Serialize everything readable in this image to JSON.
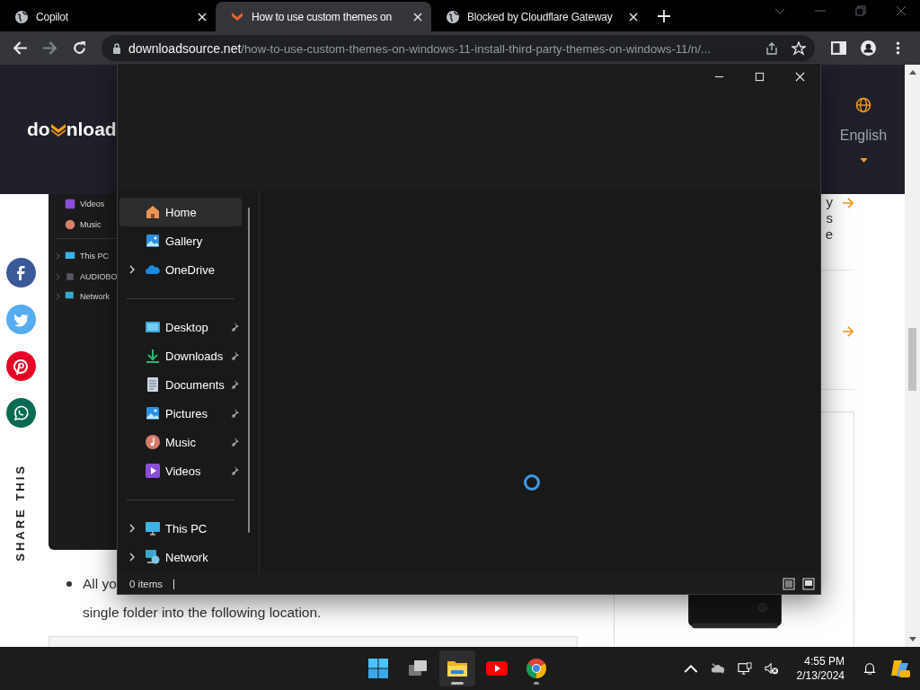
{
  "browser": {
    "tabs": [
      {
        "title": "Copilot",
        "kind": "globe",
        "selected": false
      },
      {
        "title": "How to use custom themes on",
        "kind": "site",
        "selected": true
      },
      {
        "title": "Blocked by Cloudflare Gateway",
        "kind": "globe",
        "selected": false
      }
    ],
    "address": {
      "domain": "downloadsource.net",
      "path": "/how-to-use-custom-themes-on-windows-11-install-third-party-themes-on-windows-11/n/..."
    }
  },
  "page": {
    "header": {
      "logo_start": "do",
      "logo_end": "nload",
      "language": "English"
    },
    "share": {
      "label": "SHARE THIS",
      "buttons": [
        {
          "kind": "facebook",
          "color": "#3b5998"
        },
        {
          "kind": "twitter",
          "color": "#55acee"
        },
        {
          "kind": "pinterest",
          "color": "#e60023"
        },
        {
          "kind": "whatsapp",
          "color": "#0b6b52"
        }
      ]
    },
    "article": {
      "screenshot_items": [
        {
          "label": "Videos",
          "kind": "videos",
          "expandable": false
        },
        {
          "label": "Music",
          "kind": "music",
          "expandable": false
        },
        {
          "label": "This PC",
          "kind": "pc",
          "expandable": true
        },
        {
          "label": "AUDIOBO",
          "kind": "drive",
          "expandable": true
        },
        {
          "label": "Network",
          "kind": "network",
          "expandable": true
        }
      ],
      "bullet_start": "All yo",
      "bullet_end": "single folder into the following location."
    },
    "sidebar": {
      "fragments": [
        "y",
        "s",
        "e"
      ]
    }
  },
  "explorer": {
    "nav_groups": [
      [
        {
          "label": "Home",
          "kind": "home",
          "selected": true,
          "expandable": false,
          "pinned": false
        },
        {
          "label": "Gallery",
          "kind": "gallery",
          "selected": false,
          "expandable": false,
          "pinned": false
        },
        {
          "label": "OneDrive",
          "kind": "cloud",
          "selected": false,
          "expandable": true,
          "pinned": false
        }
      ],
      [
        {
          "label": "Desktop",
          "kind": "desktop",
          "selected": false,
          "expandable": false,
          "pinned": true
        },
        {
          "label": "Downloads",
          "kind": "downloads",
          "selected": false,
          "expandable": false,
          "pinned": true
        },
        {
          "label": "Documents",
          "kind": "documents",
          "selected": false,
          "expandable": false,
          "pinned": true
        },
        {
          "label": "Pictures",
          "kind": "gallery",
          "selected": false,
          "expandable": false,
          "pinned": true
        },
        {
          "label": "Music",
          "kind": "music",
          "selected": false,
          "expandable": false,
          "pinned": true
        },
        {
          "label": "Videos",
          "kind": "videos",
          "selected": false,
          "expandable": false,
          "pinned": true
        }
      ],
      [
        {
          "label": "This PC",
          "kind": "pc",
          "selected": false,
          "expandable": true,
          "pinned": false
        },
        {
          "label": "Network",
          "kind": "network",
          "selected": false,
          "expandable": true,
          "pinned": false
        }
      ]
    ],
    "status": "0 items"
  },
  "taskbar": {
    "apps": [
      {
        "kind": "start",
        "active": false,
        "running": false
      },
      {
        "kind": "taskview",
        "active": false,
        "running": false
      },
      {
        "kind": "explorer",
        "active": true,
        "running": true
      },
      {
        "kind": "youtube",
        "active": false,
        "running": false
      },
      {
        "kind": "chrome",
        "active": false,
        "running": true
      }
    ],
    "time": "4:55 PM",
    "date": "2/13/2024"
  }
}
